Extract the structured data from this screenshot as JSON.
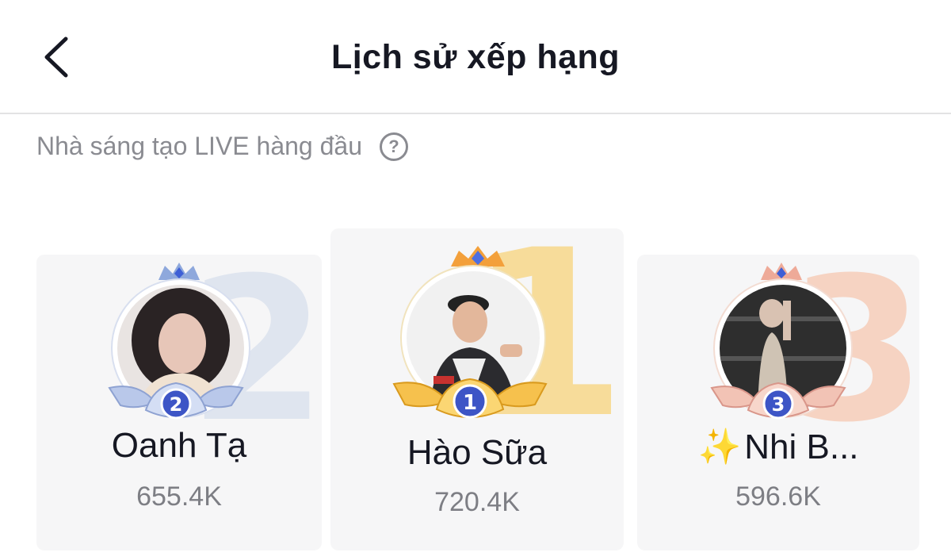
{
  "header": {
    "title": "Lịch sử xếp hạng"
  },
  "section": {
    "label": "Nhà sáng tạo LIVE hàng đầu"
  },
  "podium": [
    {
      "rank": "2",
      "name": "Oanh Tạ",
      "score": "655.4K",
      "theme": "#9cb2d8"
    },
    {
      "rank": "1",
      "name": "Hào Sữa",
      "score": "720.4K",
      "theme": "#f2c15a"
    },
    {
      "rank": "3",
      "name": "Nhi B...",
      "name_emoji": "✨",
      "score": "596.6K",
      "theme": "#f0b79e"
    }
  ]
}
